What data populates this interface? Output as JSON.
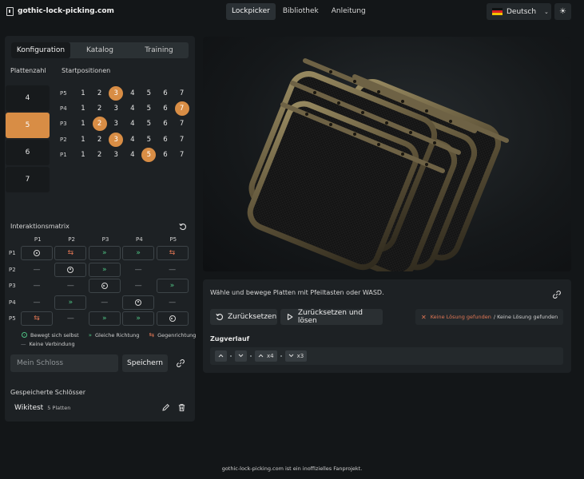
{
  "header": {
    "site_title": "gothic-lock-picking.com",
    "nav": [
      {
        "label": "Lockpicker",
        "active": true
      },
      {
        "label": "Bibliothek",
        "active": false
      },
      {
        "label": "Anleitung",
        "active": false
      }
    ],
    "language": "Deutsch",
    "theme_icon": "sun-icon"
  },
  "left": {
    "tabs": [
      {
        "label": "Konfiguration",
        "active": true
      },
      {
        "label": "Katalog",
        "active": false
      },
      {
        "label": "Training",
        "active": false
      }
    ],
    "plate_count_label": "Plattenzahl",
    "plate_counts": [
      "4",
      "5",
      "6",
      "7"
    ],
    "plate_count_selected": "5",
    "start_positions_label": "Startpositionen",
    "positions": [
      "1",
      "2",
      "3",
      "4",
      "5",
      "6",
      "7"
    ],
    "rows": [
      {
        "label": "P5",
        "selected": "3"
      },
      {
        "label": "P4",
        "selected": "7"
      },
      {
        "label": "P3",
        "selected": "2"
      },
      {
        "label": "P2",
        "selected": "3"
      },
      {
        "label": "P1",
        "selected": "5"
      }
    ],
    "matrix_title": "Interaktionsmatrix",
    "matrix_cols": [
      "P1",
      "P2",
      "P3",
      "P4",
      "P5"
    ],
    "matrix_rows": [
      {
        "label": "P1",
        "cells": [
          "self",
          "opp",
          "same",
          "same",
          "opp"
        ]
      },
      {
        "label": "P2",
        "cells": [
          "none",
          "self",
          "same",
          "none",
          "none"
        ]
      },
      {
        "label": "P3",
        "cells": [
          "none",
          "none",
          "self",
          "none",
          "same"
        ]
      },
      {
        "label": "P4",
        "cells": [
          "none",
          "same",
          "none",
          "self",
          "none"
        ]
      },
      {
        "label": "P5",
        "cells": [
          "opp",
          "none",
          "same",
          "same",
          "self"
        ]
      }
    ],
    "legend": {
      "self": "Bewegt sich selbst",
      "same": "Gleiche Richtung",
      "opp": "Gegenrichtung",
      "none": "Keine Verbindung"
    },
    "name_placeholder": "Mein Schloss",
    "save_label": "Speichern",
    "saved_title": "Gespeicherte Schlösser",
    "saved_items": [
      {
        "name": "Wikitest",
        "meta": "5 Platten"
      }
    ]
  },
  "controls": {
    "hint": "Wähle und bewege Platten mit Pfeiltasten oder WASD.",
    "reset_label": "Zurücksetzen",
    "reset_solve_label": "Zurücksetzen und lösen",
    "status_error": "Keine Lösung gefunden",
    "status_text": "/ Keine Lösung gefunden",
    "history_title": "Zugverlauf",
    "history": [
      {
        "dir": "up",
        "count": ""
      },
      {
        "dir": "down",
        "count": ""
      },
      {
        "dir": "up",
        "count": "x4"
      },
      {
        "dir": "down",
        "count": "x3"
      }
    ]
  },
  "footer": "gothic-lock-picking.com ist ein inoffizielles Fanprojekt.",
  "colors": {
    "accent": "#d88d45",
    "same": "#4fc384",
    "opposite": "#e07654",
    "panel": "#1d2124",
    "background": "#131618"
  }
}
